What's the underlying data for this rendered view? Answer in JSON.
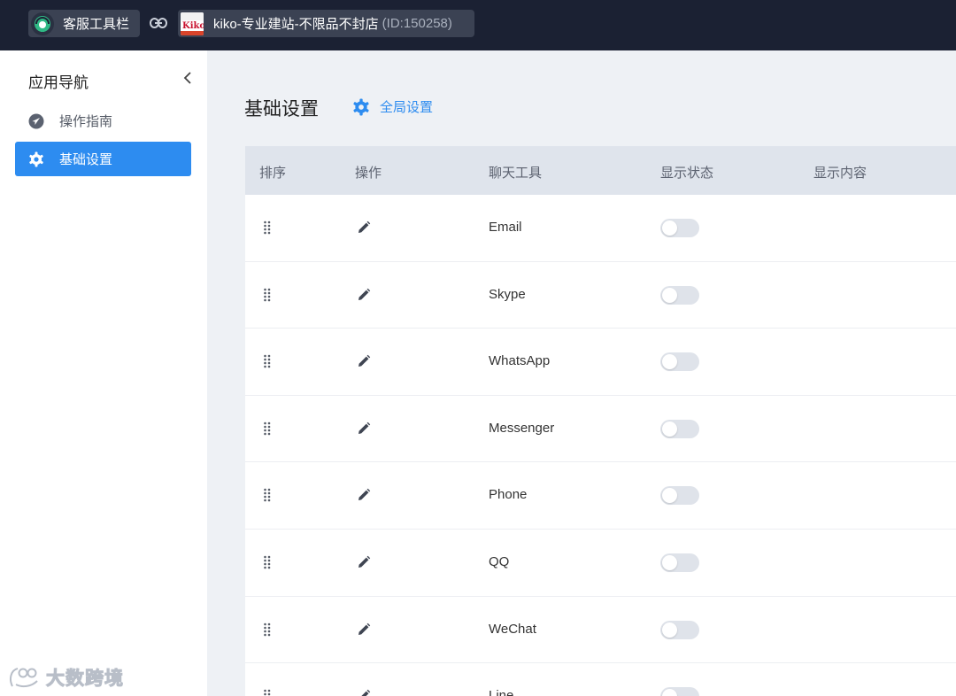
{
  "topbar": {
    "app_name": "客服工具栏",
    "store_name": "kiko-专业建站-不限品不封店",
    "store_id": "(ID:150258)",
    "store_logo_text": "Kiko"
  },
  "sidebar": {
    "title": "应用导航",
    "items": [
      {
        "label": "操作指南",
        "icon": "navigation-arrow-icon",
        "active": false
      },
      {
        "label": "基础设置",
        "icon": "gear-icon",
        "active": true
      }
    ]
  },
  "watermark": "大数跨境",
  "main": {
    "title": "基础设置",
    "global_settings_label": "全局设置",
    "columns": [
      "排序",
      "操作",
      "聊天工具",
      "显示状态",
      "显示内容"
    ],
    "rows": [
      {
        "tool": "Email",
        "enabled": false
      },
      {
        "tool": "Skype",
        "enabled": false
      },
      {
        "tool": "WhatsApp",
        "enabled": false
      },
      {
        "tool": "Messenger",
        "enabled": false
      },
      {
        "tool": "Phone",
        "enabled": false
      },
      {
        "tool": "QQ",
        "enabled": false
      },
      {
        "tool": "WeChat",
        "enabled": false
      },
      {
        "tool": "Line",
        "enabled": false
      }
    ]
  },
  "colors": {
    "topbar_bg": "#1b2133",
    "accent": "#2d8cf0",
    "header_bg": "#dfe4ec",
    "toggle_off": "#dfe3ea"
  }
}
